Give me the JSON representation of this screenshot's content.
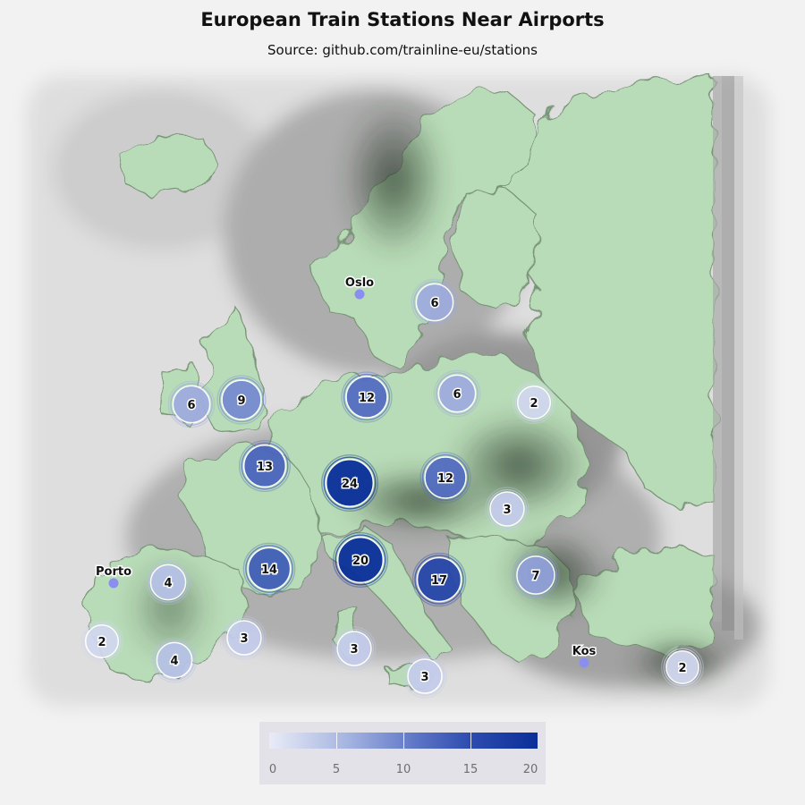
{
  "title": "European Train Stations Near Airports",
  "subtitle": "Source: github.com/trainline-eu/stations",
  "colors": {
    "background": "#f2f2f2",
    "land": "#b9dcb8",
    "land_dark": "#5c7a5b",
    "shade": "#555555",
    "city_dot": "#8a8ef0",
    "bubble_low": "#e9ecf7",
    "bubble_high": "#0a2f99"
  },
  "cities": [
    {
      "name": "Oslo"
    },
    {
      "name": "Porto"
    },
    {
      "name": "Kos"
    }
  ],
  "clusters": [
    {
      "count": 6
    },
    {
      "count": 9
    },
    {
      "count": 12
    },
    {
      "count": 6
    },
    {
      "count": 6
    },
    {
      "count": 2
    },
    {
      "count": 13
    },
    {
      "count": 24
    },
    {
      "count": 12
    },
    {
      "count": 3
    },
    {
      "count": 14
    },
    {
      "count": 20
    },
    {
      "count": 17
    },
    {
      "count": 7
    },
    {
      "count": 4
    },
    {
      "count": 2
    },
    {
      "count": 4
    },
    {
      "count": 3
    },
    {
      "count": 3
    },
    {
      "count": 3
    },
    {
      "count": 2
    }
  ],
  "legend": {
    "min": 0,
    "max": 20,
    "ticks": [
      "0",
      "5",
      "10",
      "15",
      "20"
    ]
  }
}
